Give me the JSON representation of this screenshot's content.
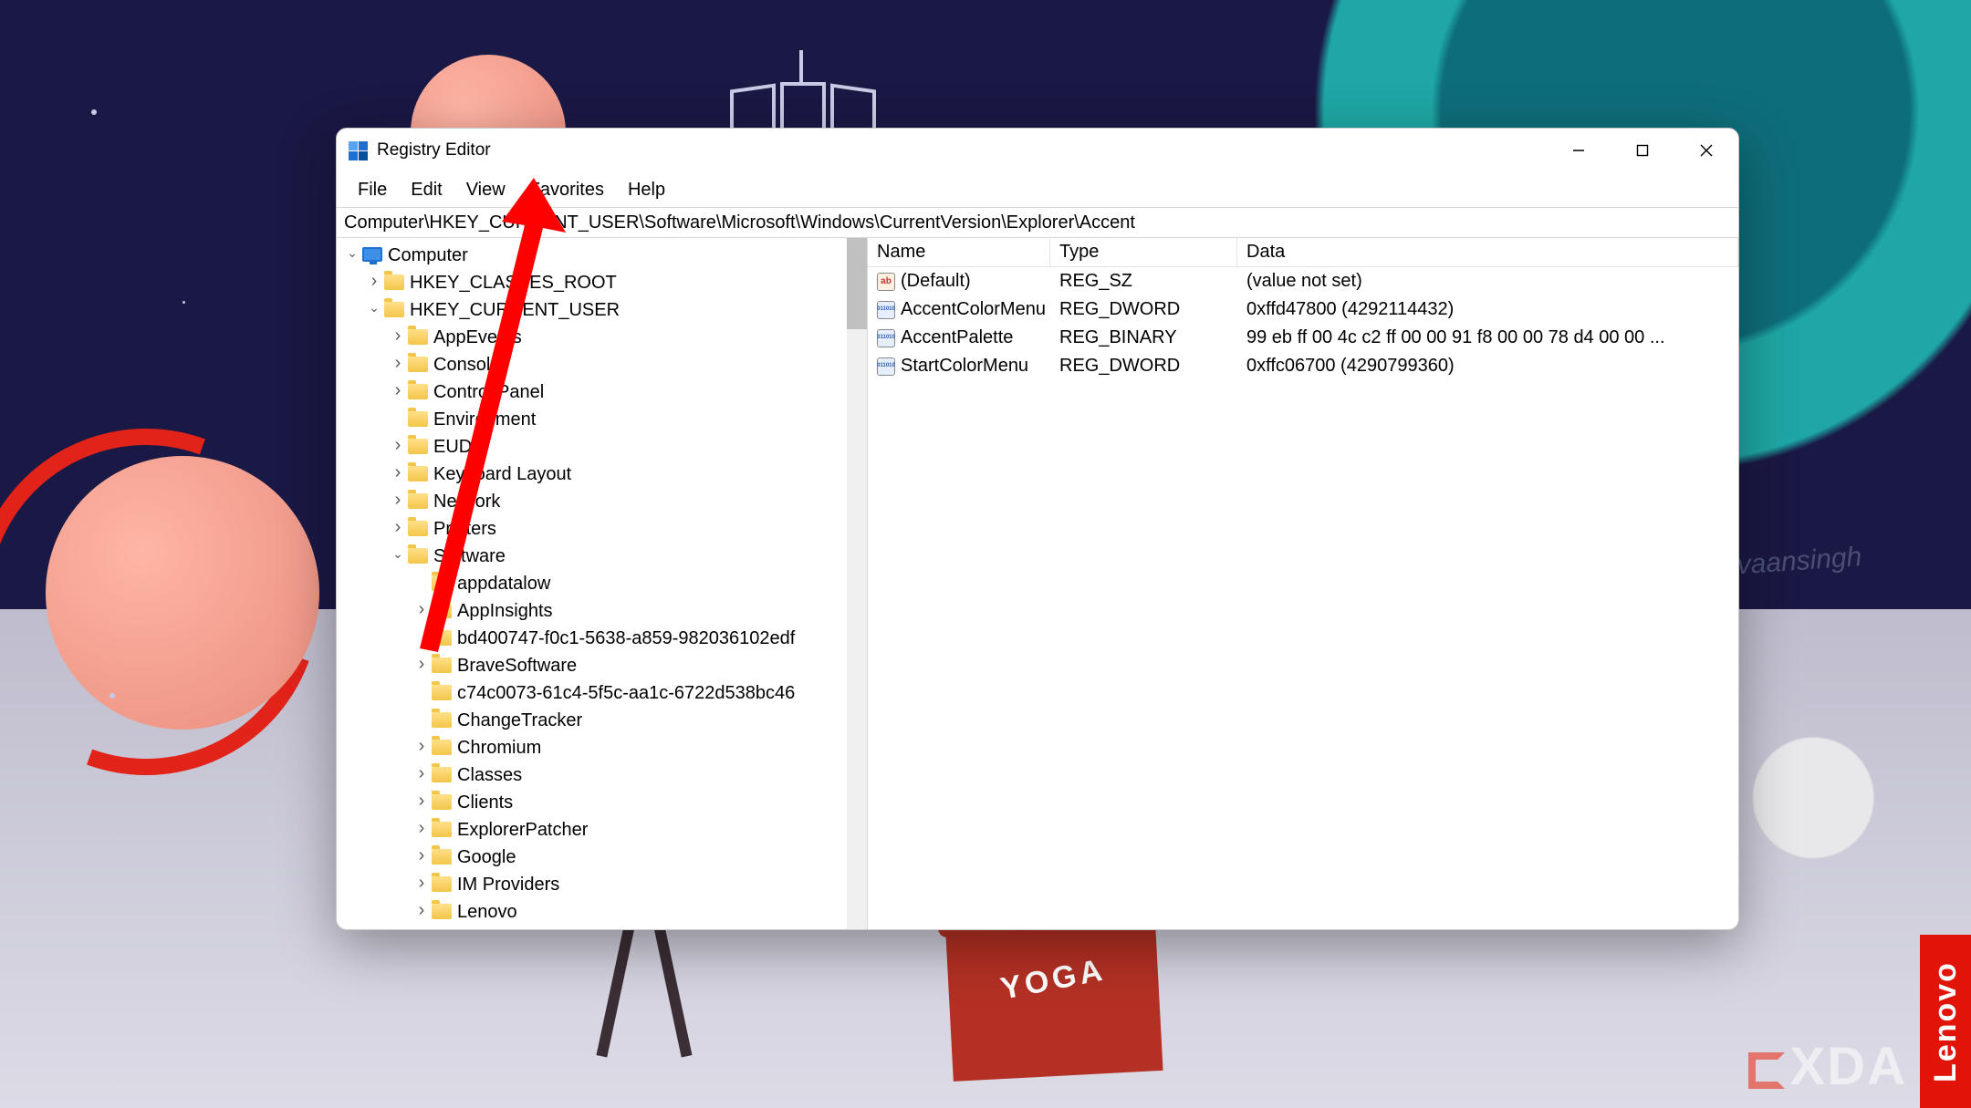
{
  "window": {
    "title": "Registry Editor",
    "menus": [
      "File",
      "Edit",
      "View",
      "Favorites",
      "Help"
    ],
    "address": "Computer\\HKEY_CURRENT_USER\\Software\\Microsoft\\Windows\\CurrentVersion\\Explorer\\Accent"
  },
  "tree": {
    "root": "Computer",
    "hives": {
      "hkcr": "HKEY_CLASSES_ROOT",
      "hkcu": "HKEY_CURRENT_USER"
    },
    "hkcu_children": [
      "AppEvents",
      "Console",
      "Control Panel",
      "Environment",
      "EUDC",
      "Keyboard Layout",
      "Network",
      "Printers",
      "Software"
    ],
    "software_children": [
      "appdatalow",
      "AppInsights",
      "bd400747-f0c1-5638-a859-982036102edf",
      "BraveSoftware",
      "c74c0073-61c4-5f5c-aa1c-6722d538bc46",
      "ChangeTracker",
      "Chromium",
      "Classes",
      "Clients",
      "ExplorerPatcher",
      "Google",
      "IM Providers",
      "Lenovo"
    ],
    "expandable_hkcu": [
      "AppEvents",
      "Console",
      "Control Panel",
      "EUDC",
      "Keyboard Layout",
      "Network",
      "Printers",
      "Software"
    ],
    "expandable_software": [
      "AppInsights",
      "BraveSoftware",
      "Chromium",
      "Classes",
      "Clients",
      "ExplorerPatcher",
      "Google",
      "IM Providers",
      "Lenovo"
    ]
  },
  "list": {
    "headers": {
      "name": "Name",
      "type": "Type",
      "data": "Data"
    },
    "rows": [
      {
        "icon": "sz",
        "name": "(Default)",
        "type": "REG_SZ",
        "data": "(value not set)"
      },
      {
        "icon": "bin",
        "name": "AccentColorMenu",
        "type": "REG_DWORD",
        "data": "0xffd47800 (4292114432)"
      },
      {
        "icon": "bin",
        "name": "AccentPalette",
        "type": "REG_BINARY",
        "data": "99 eb ff 00 4c c2 ff 00 00 91 f8 00 00 78 d4 00 00 ..."
      },
      {
        "icon": "bin",
        "name": "StartColorMenu",
        "type": "REG_DWORD",
        "data": "0xffc06700 (4290799360)"
      }
    ]
  },
  "decor": {
    "yoga": "YOGA",
    "lenovo": "Lenovo",
    "xda": "XDA"
  }
}
